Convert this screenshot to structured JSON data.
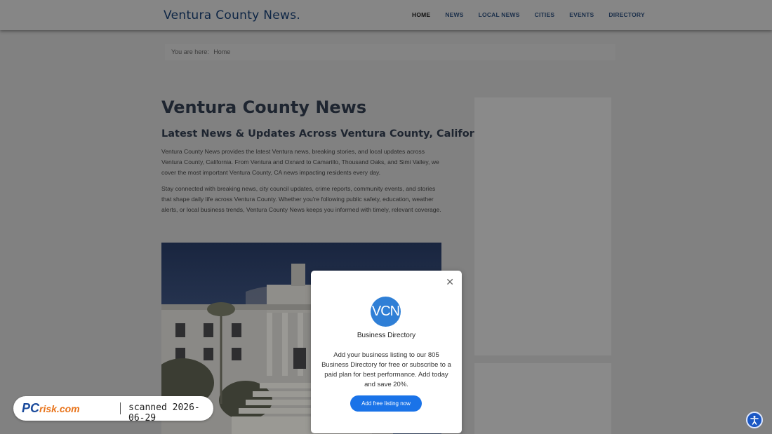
{
  "header": {
    "logo": "Ventura County News.",
    "nav": [
      "HOME",
      "NEWS",
      "LOCAL NEWS",
      "CITIES",
      "EVENTS",
      "DIRECTORY"
    ]
  },
  "breadcrumb": {
    "prefix": "You are here:",
    "current": "Home"
  },
  "main": {
    "title": "Ventura County News",
    "subtitle": "Latest News & Updates Across Ventura County, California",
    "paragraphs": [
      "Ventura County News provides the latest Ventura news, breaking stories, and local updates across Ventura County, California. From Ventura and Oxnard to Camarillo, Thousand Oaks, and Simi Valley, we cover the most important Ventura County, CA news impacting residents every day.",
      "Stay connected with breaking news, city council updates, crime reports, community events, and stories that shape daily life across Ventura County. Whether you're following public safety, education, weather alerts, or local business trends, Ventura County News keeps you informed with timely, relevant coverage."
    ]
  },
  "modal": {
    "logo_text": "VCN",
    "heading": "Business Directory",
    "body": "Add your business listing to our 805 Business Directory for free or subscribe to a paid plan for best performance. Add today and save 20%.",
    "cta": "Add free listing now",
    "close_symbol": "✕"
  },
  "watermark": {
    "brand": "PC",
    "brand_suffix": "risk.com",
    "scan_text": "scanned 2026-06-29"
  },
  "colors": {
    "overlay": "#818181",
    "brand": "#0d2545",
    "cta": "#1a73e8",
    "a11y": "#1a57c4"
  }
}
